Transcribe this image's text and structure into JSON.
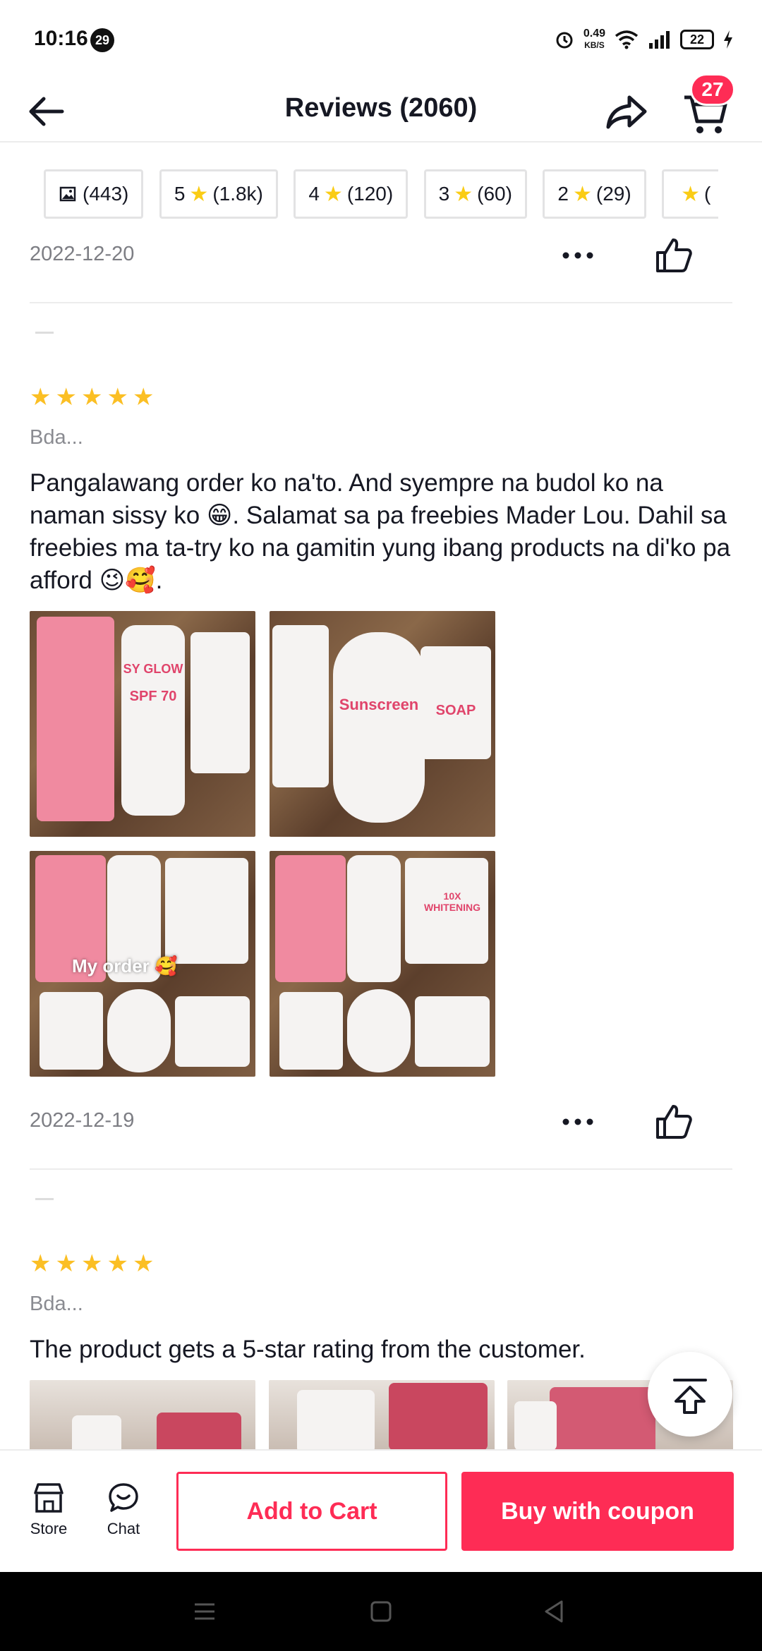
{
  "status_bar": {
    "time": "10:16",
    "notification_count": "29",
    "net_speed_value": "0.49",
    "net_speed_unit": "KB/S",
    "battery": "22"
  },
  "header": {
    "title": "Reviews (2060)",
    "cart_count": "27"
  },
  "filters": [
    {
      "label": "(443)",
      "icon": "image-icon"
    },
    {
      "prefix": "5",
      "label": "(1.8k)"
    },
    {
      "prefix": "4",
      "label": "(120)"
    },
    {
      "prefix": "3",
      "label": "(60)"
    },
    {
      "prefix": "2",
      "label": "(29)"
    },
    {
      "prefix": "",
      "label": "("
    }
  ],
  "reviews": [
    {
      "date": "2022-12-20"
    },
    {
      "reviewer": "Bda...",
      "rating": 5,
      "text": "Pangalawang order ko na'to. And syempre na budol ko na naman sissy ko 😁. Salamat sa pa freebies Mader Lou. Dahil sa freebies ma ta-try ko na gamitin yung ibang products na di'ko pa afford 😉🥰.",
      "photo_caption": "My order 🥰",
      "photo_texts": [
        "SPF 70",
        "SY GLOW",
        "Sunscreen",
        "10X WHITENING",
        "SOAP"
      ],
      "date": "2022-12-19"
    },
    {
      "reviewer": "Bda...",
      "rating": 5,
      "text": "The product gets a 5-star rating from the customer."
    }
  ],
  "bottom_bar": {
    "store_label": "Store",
    "chat_label": "Chat",
    "add_to_cart": "Add to Cart",
    "buy_with_coupon": "Buy with coupon"
  },
  "colors": {
    "accent": "#fe2c55",
    "star": "#fbbf24",
    "muted_text": "#7d7e84"
  }
}
